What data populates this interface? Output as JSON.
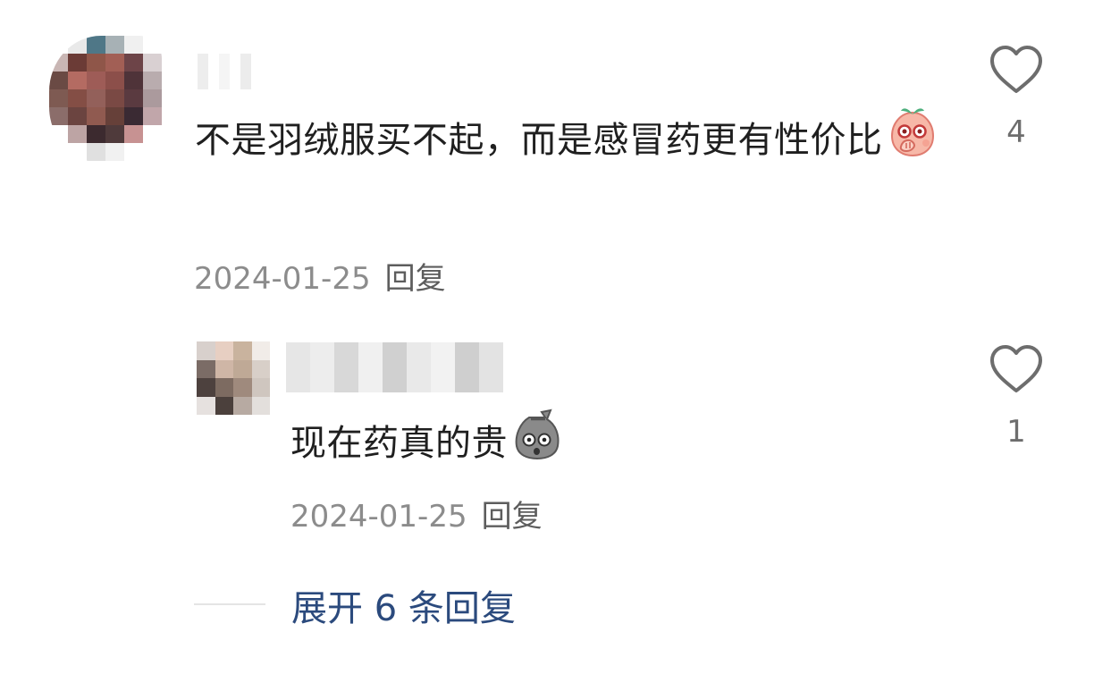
{
  "comment": {
    "avatar_pixels": [
      "#ffffff",
      "#e9e9e9",
      "#4f7787",
      "#a7b1b5",
      "#f0f0f0",
      "#ffffff",
      "#c9b6b4",
      "#6b3b36",
      "#8f5649",
      "#a25f55",
      "#6d4448",
      "#d9d0d2",
      "#6a4a44",
      "#b46b62",
      "#9e5c57",
      "#8c4f4a",
      "#4f3339",
      "#b9acae",
      "#7e5a52",
      "#844e45",
      "#93605a",
      "#7a4944",
      "#5a3a40",
      "#ab9a9d",
      "#8b6d6a",
      "#6b4440",
      "#905a50",
      "#664039",
      "#3a2a33",
      "#c1a6aa",
      "#ffffff",
      "#bda4a4",
      "#3c2a2f",
      "#4f3a3b",
      "#c79292",
      "#ffffff",
      "#ffffff",
      "#ffffff",
      "#e0e0e0",
      "#f1f1f1",
      "#ffffff",
      "#ffffff"
    ],
    "username_blocks": [
      "#ededed",
      "#ffffff",
      "#f5f5f5",
      "#ffffff",
      "#ececec"
    ],
    "text": "不是羽绒服买不起，而是感冒药更有性价比",
    "emoji": "peach-covering-mouth-emoji",
    "date": "2024-01-25",
    "reply_label": "回复",
    "like_count": "4"
  },
  "reply": {
    "avatar_pixels": [
      "#d8d0cc",
      "#e7cfc2",
      "#c9b39e",
      "#f1ece8",
      "#7b6c66",
      "#cfb6a6",
      "#bfa996",
      "#d8cfc8",
      "#4d413e",
      "#7d6b61",
      "#9f8a7d",
      "#cfc6bf",
      "#e6e1df",
      "#4b403c",
      "#b7aaa2",
      "#e3dfdc"
    ],
    "username_blocks": [
      "#e6e6e6",
      "#ededed",
      "#d8d8d8",
      "#f0f0f0",
      "#d0d0d0",
      "#e9e9e9",
      "#f2f2f2",
      "#cfcfcf",
      "#e3e3e3"
    ],
    "text": "现在药真的贵",
    "emoji": "gray-bag-shocked-emoji",
    "date": "2024-01-25",
    "reply_label": "回复",
    "like_count": "1"
  },
  "expand_label": "展开 6 条回复",
  "colors": {
    "link": "#2b4a7d",
    "meta": "#8c8c8c",
    "text": "#1f1f1f"
  }
}
